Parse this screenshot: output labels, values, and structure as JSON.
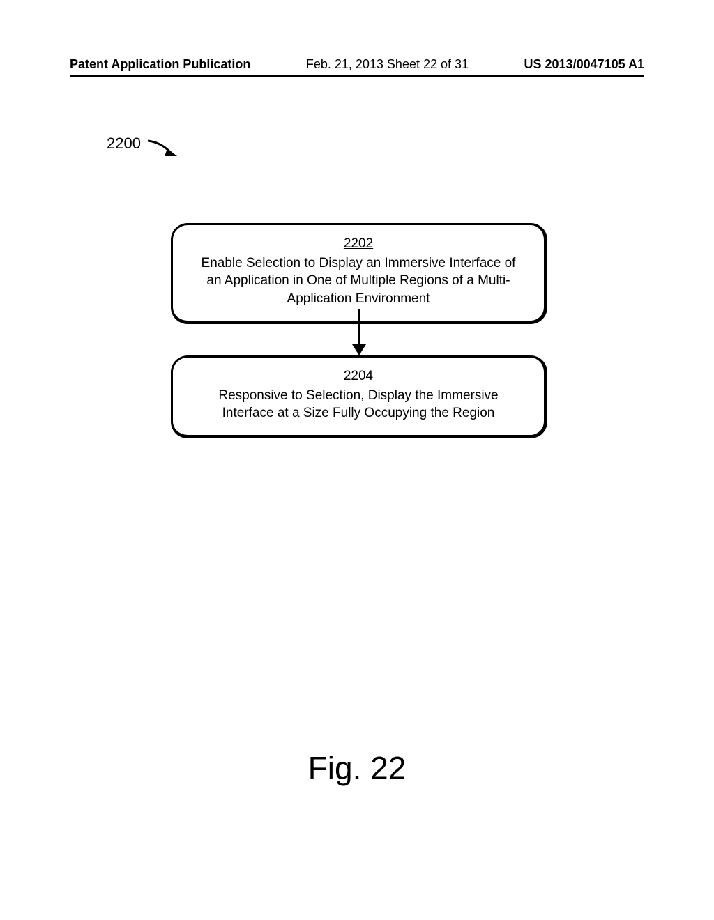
{
  "header": {
    "pub_type": "Patent Application Publication",
    "date_sheet": "Feb. 21, 2013  Sheet 22 of 31",
    "pub_number": "US 2013/0047105 A1"
  },
  "ref_label": "2200",
  "steps": [
    {
      "num": "2202",
      "text": "Enable Selection to Display an Immersive Interface of an Application in One of Multiple Regions of a Multi-Application Environment"
    },
    {
      "num": "2204",
      "text": "Responsive to Selection, Display the Immersive Interface at a Size Fully Occupying the Region"
    }
  ],
  "figure_label": "Fig. 22"
}
